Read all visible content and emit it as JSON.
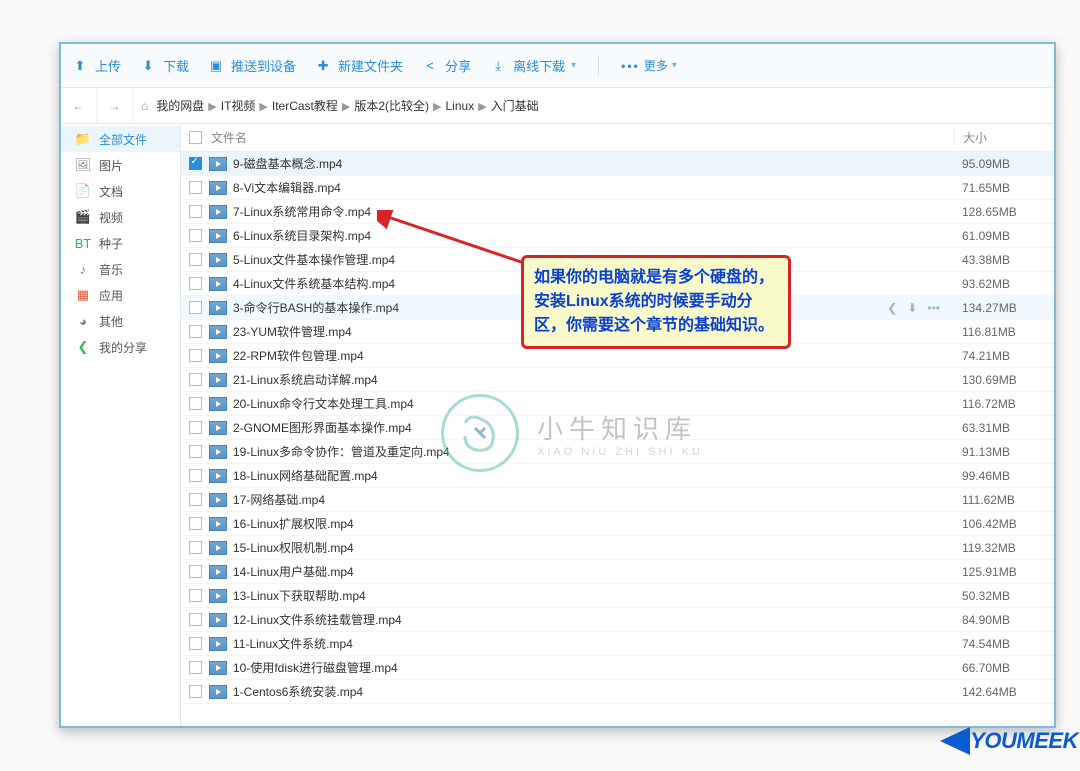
{
  "toolbar": {
    "upload": "上传",
    "download": "下载",
    "push": "推送到设备",
    "newfolder": "新建文件夹",
    "share": "分享",
    "offline": "离线下载",
    "more": "更多"
  },
  "breadcrumb": [
    "我的网盘",
    "IT视频",
    "IterCast教程",
    "版本2(比较全)",
    "Linux",
    "入门基础"
  ],
  "sidebar": {
    "items": [
      {
        "label": "全部文件",
        "icon": "📁",
        "color": "#e6a23c"
      },
      {
        "label": "图片",
        "icon": "🖼",
        "color": "#888"
      },
      {
        "label": "文档",
        "icon": "📄",
        "color": "#888"
      },
      {
        "label": "视频",
        "icon": "🎬",
        "color": "#888"
      },
      {
        "label": "种子",
        "icon": "BT",
        "color": "#35b558"
      },
      {
        "label": "音乐",
        "icon": "♪",
        "color": "#3a8edb"
      },
      {
        "label": "应用",
        "icon": "▦",
        "color": "#e05a3a"
      },
      {
        "label": "其他",
        "icon": "◕",
        "color": "#888"
      },
      {
        "label": "我的分享",
        "icon": "❮",
        "color": "#35b558"
      }
    ]
  },
  "columns": {
    "name": "文件名",
    "size": "大小"
  },
  "files": [
    {
      "name": "9-磁盘基本概念.mp4",
      "size": "95.09MB",
      "selected": true
    },
    {
      "name": "8-Vi文本编辑器.mp4",
      "size": "71.65MB"
    },
    {
      "name": "7-Linux系统常用命令.mp4",
      "size": "128.65MB"
    },
    {
      "name": "6-Linux系统目录架构.mp4",
      "size": "61.09MB"
    },
    {
      "name": "5-Linux文件基本操作管理.mp4",
      "size": "43.38MB"
    },
    {
      "name": "4-Linux文件系统基本结构.mp4",
      "size": "93.62MB"
    },
    {
      "name": "3-命令行BASH的基本操作.mp4",
      "size": "134.27MB",
      "hover": true
    },
    {
      "name": "23-YUM软件管理.mp4",
      "size": "116.81MB"
    },
    {
      "name": "22-RPM软件包管理.mp4",
      "size": "74.21MB"
    },
    {
      "name": "21-Linux系统启动详解.mp4",
      "size": "130.69MB"
    },
    {
      "name": "20-Linux命令行文本处理工具.mp4",
      "size": "116.72MB"
    },
    {
      "name": "2-GNOME图形界面基本操作.mp4",
      "size": "63.31MB"
    },
    {
      "name": "19-Linux多命令协作：管道及重定向.mp4",
      "size": "91.13MB"
    },
    {
      "name": "18-Linux网络基础配置.mp4",
      "size": "99.46MB"
    },
    {
      "name": "17-网络基础.mp4",
      "size": "111.62MB"
    },
    {
      "name": "16-Linux扩展权限.mp4",
      "size": "106.42MB"
    },
    {
      "name": "15-Linux权限机制.mp4",
      "size": "119.32MB"
    },
    {
      "name": "14-Linux用户基础.mp4",
      "size": "125.91MB"
    },
    {
      "name": "13-Linux下获取帮助.mp4",
      "size": "50.32MB"
    },
    {
      "name": "12-Linux文件系统挂载管理.mp4",
      "size": "84.90MB"
    },
    {
      "name": "11-Linux文件系统.mp4",
      "size": "74.54MB"
    },
    {
      "name": "10-使用fdisk进行磁盘管理.mp4",
      "size": "66.70MB"
    },
    {
      "name": "1-Centos6系统安装.mp4",
      "size": "142.64MB"
    }
  ],
  "callout": "如果你的电脑就是有多个硬盘的，安装Linux系统的时候要手动分区，你需要这个章节的基础知识。",
  "watermark": {
    "title": "小牛知识库",
    "sub": "XIAO NIU ZHI SHI KU"
  },
  "youmeek": "YOUMEEK"
}
